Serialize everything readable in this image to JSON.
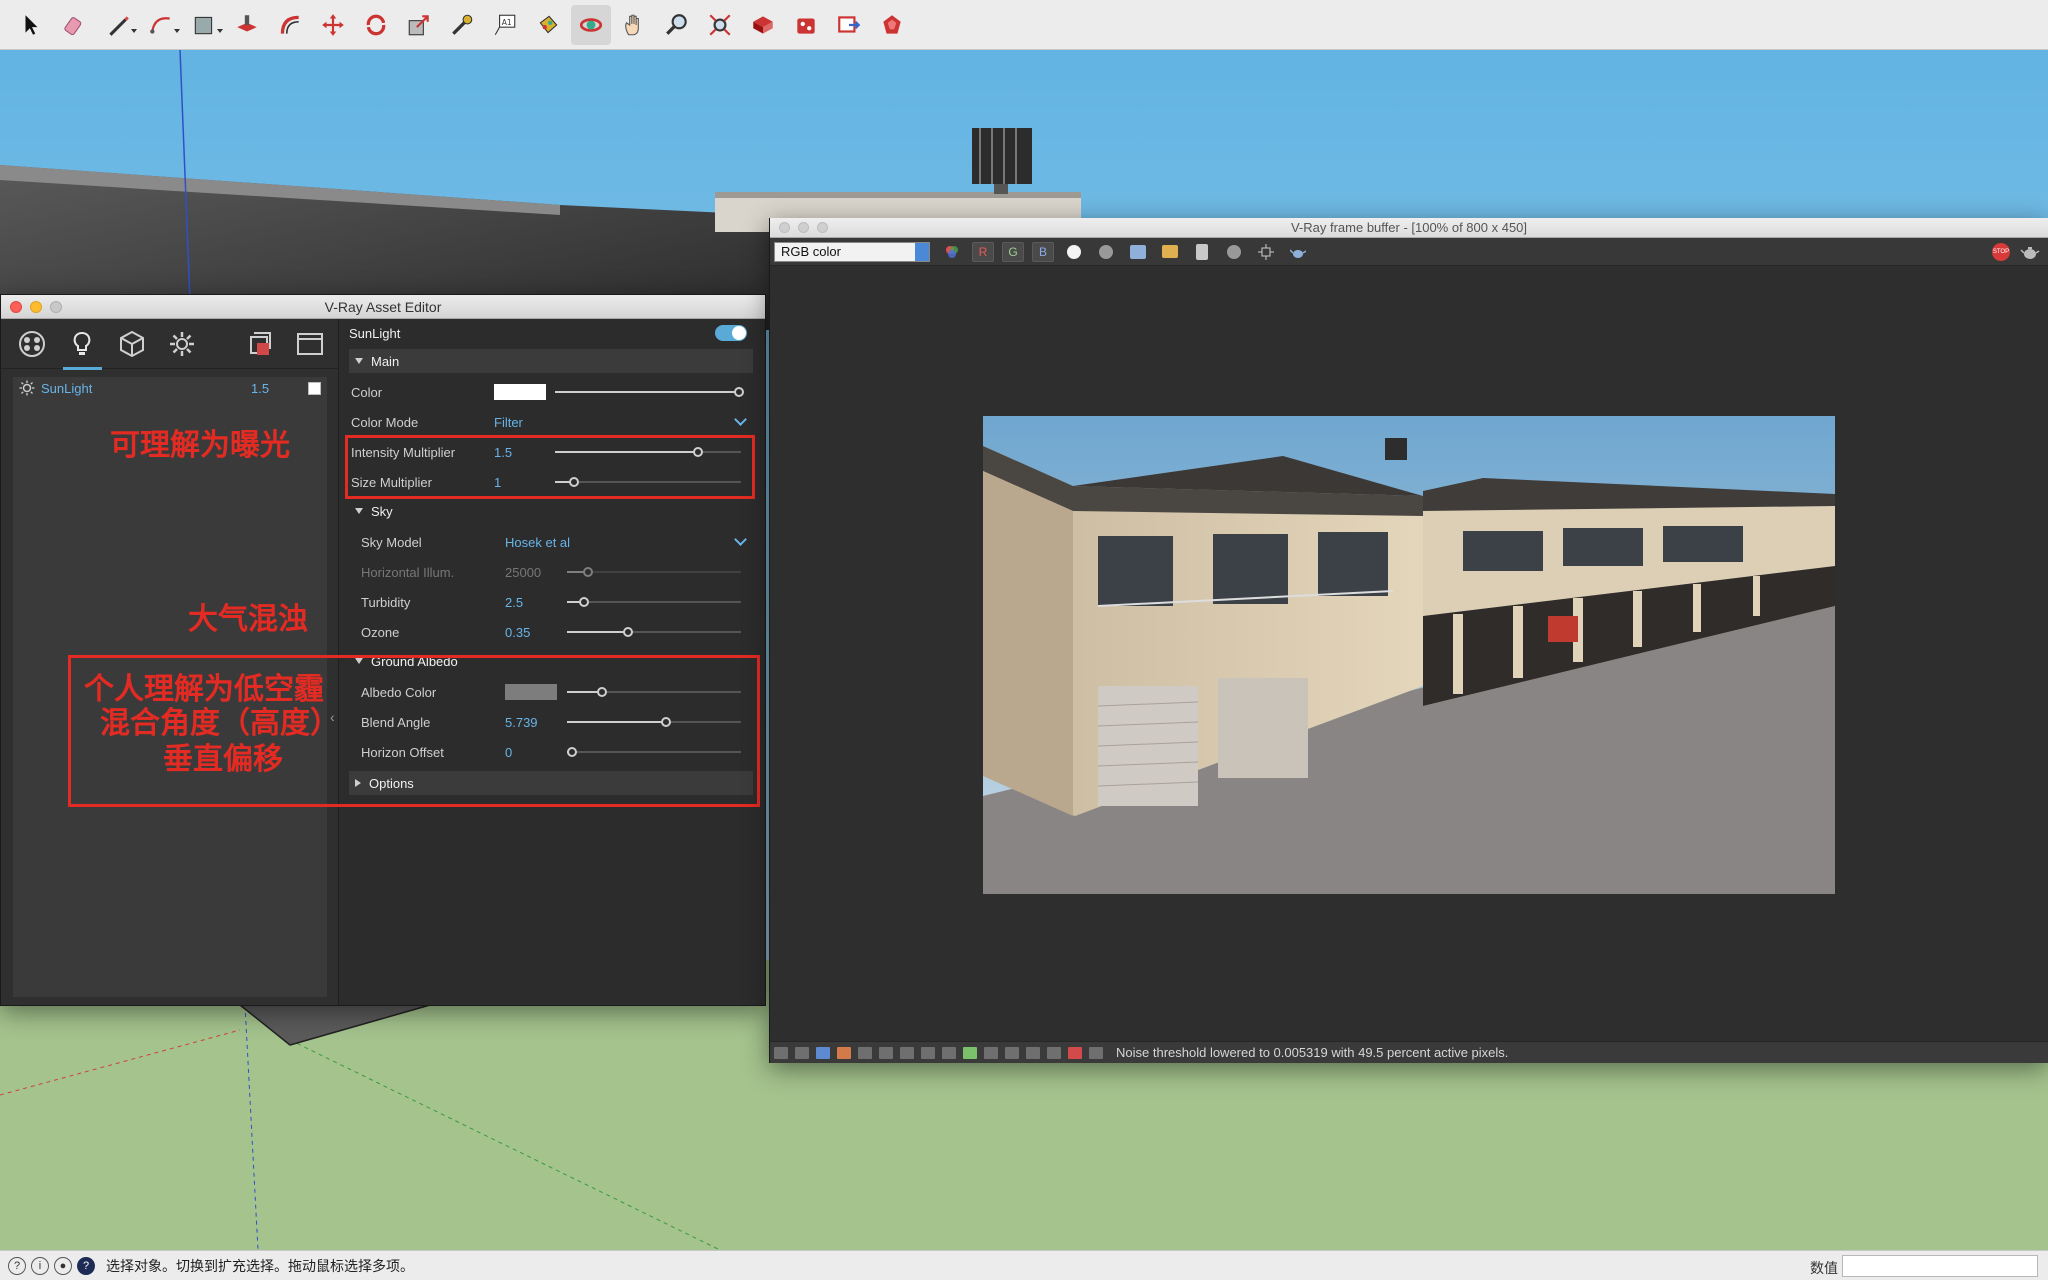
{
  "toolbar": {
    "tools": [
      {
        "icon": "select-arrow-icon"
      },
      {
        "icon": "eraser-icon"
      },
      {
        "icon": "line-pencil-icon"
      },
      {
        "icon": "arc-icon"
      },
      {
        "icon": "rectangle-icon"
      },
      {
        "icon": "push-pull-icon"
      },
      {
        "icon": "offset-icon"
      },
      {
        "icon": "move-icon"
      },
      {
        "icon": "rotate-icon"
      },
      {
        "icon": "scale-icon"
      },
      {
        "icon": "tape-measure-icon"
      },
      {
        "icon": "text-icon"
      },
      {
        "icon": "paint-bucket-icon"
      },
      {
        "icon": "orbit-icon"
      },
      {
        "icon": "pan-icon"
      },
      {
        "icon": "zoom-icon"
      },
      {
        "icon": "zoom-extents-icon"
      },
      {
        "icon": "warehouse-icon"
      },
      {
        "icon": "extension-warehouse-icon"
      },
      {
        "icon": "send-to-layout-icon"
      },
      {
        "icon": "extension-manager-icon"
      }
    ]
  },
  "asset_editor": {
    "title": "V-Ray Asset Editor",
    "tabs": [
      "materials-tab-icon",
      "lights-tab-icon",
      "geometry-tab-icon",
      "settings-tab-icon",
      "render-elements-icon",
      "textures-icon"
    ],
    "list": {
      "item_name": "SunLight",
      "item_value": "1.5"
    },
    "panel": {
      "header": "SunLight",
      "main": {
        "title": "Main",
        "color_label": "Color",
        "color_mode_label": "Color Mode",
        "color_mode_value": "Filter",
        "intensity_label": "Intensity Multiplier",
        "intensity_value": "1.5",
        "size_label": "Size Multiplier",
        "size_value": "1"
      },
      "sky": {
        "title": "Sky",
        "model_label": "Sky Model",
        "model_value": "Hosek et al",
        "horiz_label": "Horizontal Illum.",
        "horiz_value": "25000",
        "turbidity_label": "Turbidity",
        "turbidity_value": "2.5",
        "ozone_label": "Ozone",
        "ozone_value": "0.35"
      },
      "ground": {
        "title": "Ground Albedo",
        "albedo_label": "Albedo Color",
        "blend_label": "Blend Angle",
        "blend_value": "5.739",
        "horizon_label": "Horizon Offset",
        "horizon_value": "0"
      },
      "options": {
        "title": "Options"
      }
    },
    "slider_levels": {
      "color": 0.99,
      "intensity": 0.77,
      "size": 0.1,
      "horiz": 0.12,
      "turbidity": 0.1,
      "ozone": 0.35,
      "albedo": 0.2,
      "blend": 0.57,
      "horizon": 0.03
    }
  },
  "annotations": {
    "exposure": "可理解为曝光",
    "turbidity": "大气混浊",
    "ground_line1": "个人理解为低空霾",
    "ground_line2": "混合角度（高度）",
    "ground_line3": "垂直偏移",
    "color": "#e32b23"
  },
  "vfb": {
    "title": "V-Ray frame buffer - [100% of 800 x 450]",
    "channel": "RGB color",
    "channel_buttons": [
      "R",
      "G",
      "B"
    ],
    "stop_label": "STOP",
    "status": "Noise threshold lowered to 0.005319 with 49.5 percent active pixels."
  },
  "statusbar": {
    "text": "选择对象。切换到扩充选择。拖动鼠标选择多项。",
    "measure_label": "数值"
  }
}
